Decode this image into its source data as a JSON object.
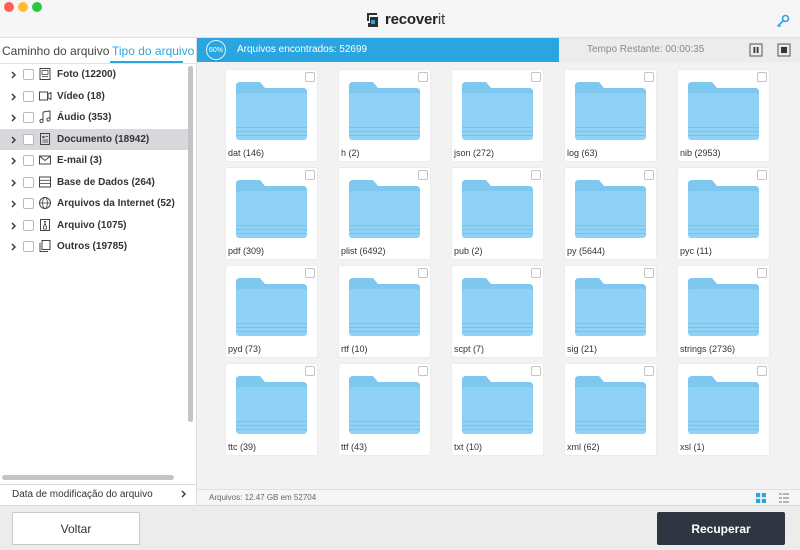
{
  "app": {
    "name_bold": "recover",
    "name_light": "it",
    "logo_icon": "recoverit-logo-icon",
    "key_icon": "key-icon",
    "accent": "#2ba5e0",
    "dark_button": "#2f3642"
  },
  "sidebar": {
    "tabs": [
      {
        "label": "Caminho do arquivo",
        "active": false
      },
      {
        "label": "Tipo do arquivo",
        "active": true
      }
    ],
    "items": [
      {
        "label": "Foto (12200)",
        "icon": "photo-icon",
        "selected": false
      },
      {
        "label": "Vídeo (18)",
        "icon": "video-icon",
        "selected": false
      },
      {
        "label": "Áudio (353)",
        "icon": "audio-icon",
        "selected": false
      },
      {
        "label": "Documento (18942)",
        "icon": "document-icon",
        "selected": true
      },
      {
        "label": "E-mail (3)",
        "icon": "email-icon",
        "selected": false
      },
      {
        "label": "Base de Dados (264)",
        "icon": "database-icon",
        "selected": false
      },
      {
        "label": "Arquivos da Internet (52)",
        "icon": "globe-icon",
        "selected": false
      },
      {
        "label": "Arquivo (1075)",
        "icon": "archive-icon",
        "selected": false
      },
      {
        "label": "Outros (19785)",
        "icon": "other-files-icon",
        "selected": false
      }
    ],
    "footer_label": "Data de modificação do arquivo"
  },
  "progress": {
    "percent": 60,
    "percent_label": "60%",
    "found_label": "Arquivos encontrados: 52699",
    "remaining_label": "Tempo Restante: 00:00:35"
  },
  "folders": [
    {
      "label": "dat (146)"
    },
    {
      "label": "h (2)"
    },
    {
      "label": "json (272)"
    },
    {
      "label": "log (63)"
    },
    {
      "label": "nib (2953)"
    },
    {
      "label": "pdf (309)"
    },
    {
      "label": "plist (6492)"
    },
    {
      "label": "pub (2)"
    },
    {
      "label": "py (5644)"
    },
    {
      "label": "pyc (11)"
    },
    {
      "label": "pyd (73)"
    },
    {
      "label": "rtf (10)"
    },
    {
      "label": "scpt (7)"
    },
    {
      "label": "sig (21)"
    },
    {
      "label": "strings (2736)"
    },
    {
      "label": "ttc (39)"
    },
    {
      "label": "ttf (43)"
    },
    {
      "label": "txt (10)"
    },
    {
      "label": "xml (62)"
    },
    {
      "label": "xsl (1)"
    }
  ],
  "status": {
    "text": "Arquivos: 12.47 GB em 52704"
  },
  "buttons": {
    "back": "Voltar",
    "recover": "Recuperar"
  }
}
